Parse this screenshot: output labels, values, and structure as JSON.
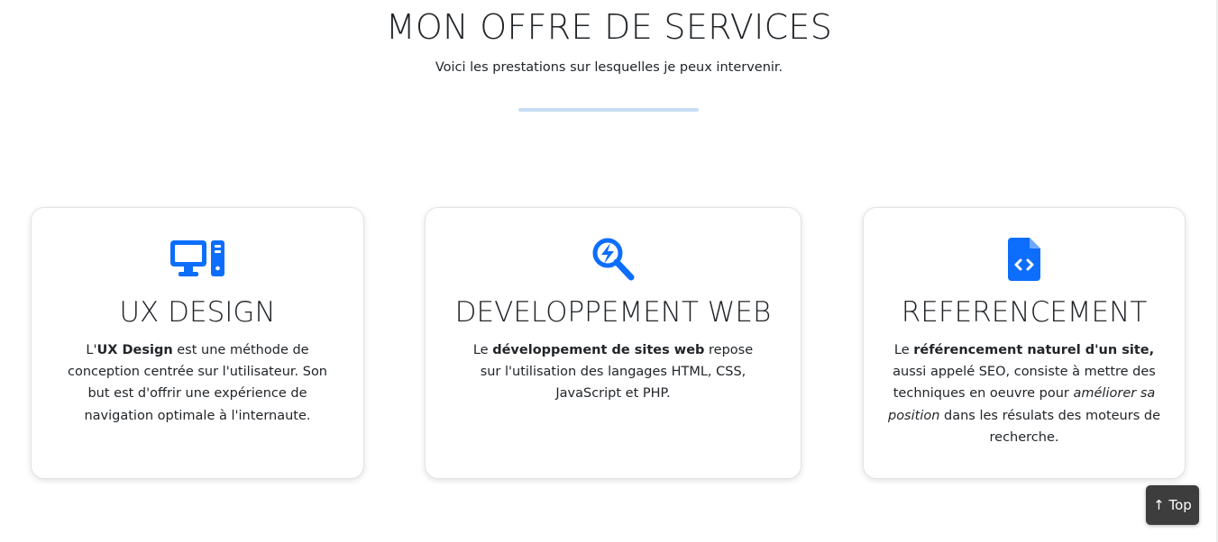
{
  "header": {
    "title": "MON OFFRE DE SERVICES",
    "subtitle": "Voici les prestations sur lesquelles je peux intervenir."
  },
  "colors": {
    "accent": "#0d6efd",
    "divider": "#c5dcf3",
    "top_button_bg": "#3d3d3d"
  },
  "cards": [
    {
      "icon": "desktop-computer-icon",
      "title": "UX DESIGN",
      "text": {
        "prefix": "L'",
        "bold": "UX Design",
        "rest": " est une méthode de conception centrée sur l'utilisateur. Son but est d'offrir une expérience de navigation optimale à l'internaute."
      }
    },
    {
      "icon": "search-bolt-icon",
      "title": "DEVELOPPEMENT WEB",
      "text": {
        "prefix": "Le ",
        "bold": "développement de sites web",
        "rest": " repose sur l'utilisation des langages HTML, CSS, JavaScript et PHP."
      }
    },
    {
      "icon": "code-file-icon",
      "title": "REFERENCEMENT",
      "text": {
        "prefix": "Le ",
        "bold": "référencement naturel d'un site,",
        "middle": " aussi appelé SEO, consiste à mettre des techniques en oeuvre pour ",
        "italic": "améliorer sa position",
        "rest": " dans les résulats des moteurs de recherche."
      }
    }
  ],
  "top_button": {
    "label": "↑ Top"
  }
}
